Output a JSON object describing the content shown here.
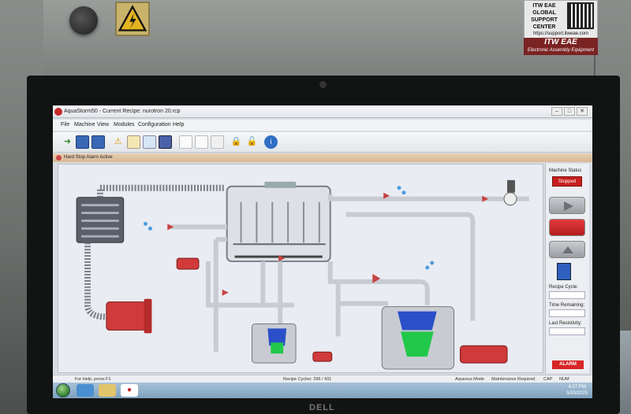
{
  "window": {
    "title": "AquaStorm50 - Current Recipe: nurotron 20.rcp",
    "controls": [
      "–",
      "□",
      "✕"
    ]
  },
  "menu": [
    "File",
    "Machine",
    "View",
    "Modules",
    "Configuration",
    "Help"
  ],
  "toolbar_icons": [
    "open-arrow-icon",
    "save-icon",
    "save-as-icon",
    "alarm-warning-icon",
    "edit-recipe-icon",
    "notes-icon",
    "list-icon",
    "chart-icon",
    "chart-icon",
    "grid-icon",
    "lock-icon",
    "unlock-icon",
    "info-icon"
  ],
  "alarm_bar": {
    "text": "Hard Stop Alarm Active"
  },
  "status_panel": {
    "machine_status_label": "Machine Status",
    "machine_status_value": "Stopped",
    "recipe_cycle_label": "Recipe Cycle:",
    "time_remaining_label": "Time Remaining:",
    "last_resistivity_label": "Last Resistivity:",
    "alarm_button": "ALARM"
  },
  "statusbar": {
    "help": "For Help, press F1",
    "recipe_cycles": "Recipe Cycles:  296 / 431",
    "mode": "Aqueous Mode",
    "maintenance": "Maintenance Required",
    "caps": "CAP",
    "num": "NUM"
  },
  "taskbar": {
    "time": "4:27 PM",
    "date": "5/30/2025"
  },
  "physical_labels": {
    "itw_lines": [
      "ITW EAE",
      "GLOBAL",
      "SUPPORT",
      "CENTER"
    ],
    "itw_url": "https://support.itweae.com",
    "itw_brand": "ITW EAE",
    "itw_brand_sub": "Electronic Assembly Equipment",
    "monitor_brand": "DELL"
  },
  "colors": {
    "stopped": "#c81e1e",
    "pipe": "#c8ccd2",
    "pump": "#d03a3a",
    "water": "#22c84a",
    "level_blue": "#2a4fc8"
  }
}
